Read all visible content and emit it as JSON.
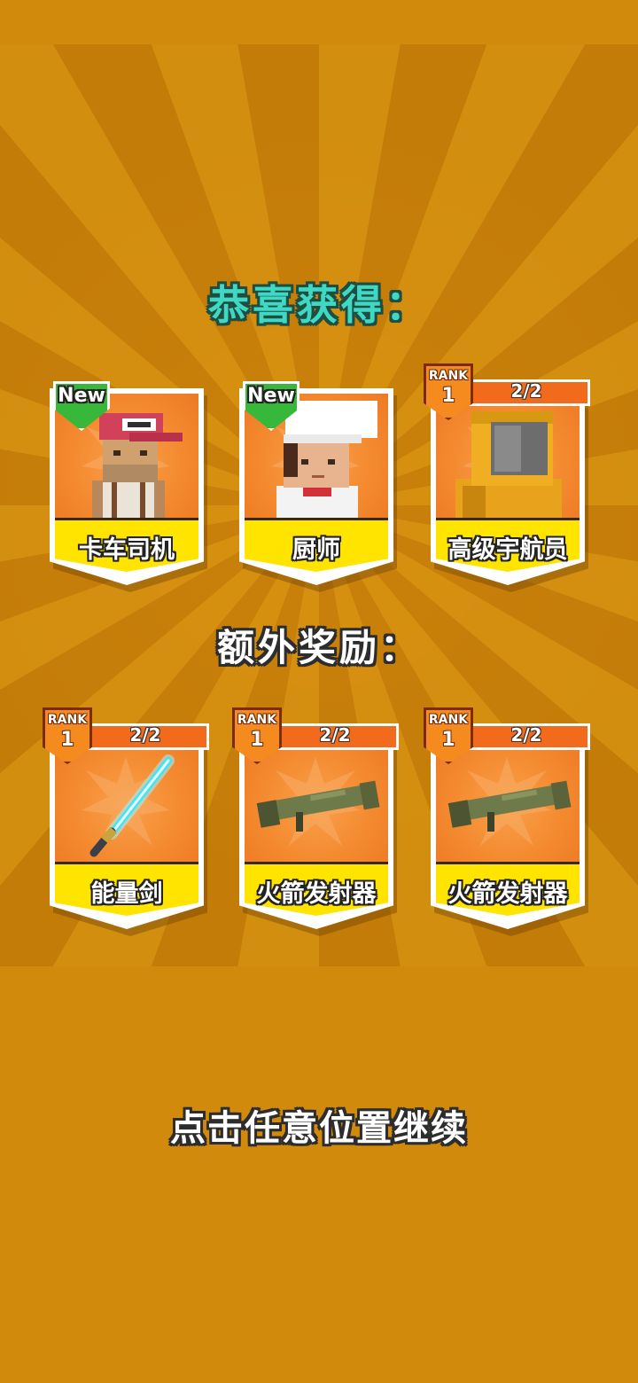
{
  "title": "恭喜获得：",
  "bonus_title": "额外奖励：",
  "continue_text": "点击任意位置继续",
  "new_tag": "New",
  "rank_word": "RANK",
  "main_rewards": [
    {
      "name": "卡车司机",
      "badge": "New",
      "icon": "truck-driver-character"
    },
    {
      "name": "厨师",
      "badge": "New",
      "icon": "chef-character"
    },
    {
      "name": "高级宇航员",
      "rank": "1",
      "count": "2/2",
      "icon": "astronaut-character"
    }
  ],
  "bonus_rewards": [
    {
      "name": "能量剑",
      "rank": "1",
      "count": "2/2",
      "icon": "energy-sword"
    },
    {
      "name": "火箭发射器",
      "rank": "1",
      "count": "2/2",
      "icon": "rocket-launcher"
    },
    {
      "name": "火箭发射器",
      "rank": "1",
      "count": "2/2",
      "icon": "rocket-launcher"
    }
  ],
  "colors": {
    "background": "#d18a0c",
    "title_teal": "#3ed8c5",
    "card_orange": "#f48a30",
    "label_yellow": "#ffe400",
    "new_green": "#37b83a",
    "rank_orange": "#f26a1c"
  }
}
